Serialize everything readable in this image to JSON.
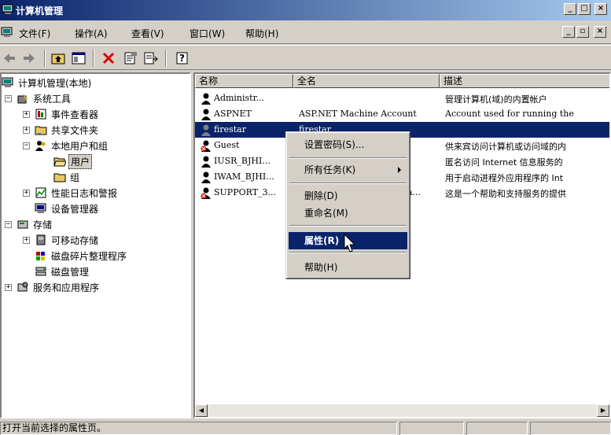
{
  "window": {
    "title": "计算机管理"
  },
  "menubar": {
    "items": [
      "文件(F)",
      "操作(A)",
      "查看(V)",
      "窗口(W)",
      "帮助(H)"
    ]
  },
  "tree": {
    "items": [
      {
        "label": "计算机管理(本地)"
      },
      {
        "label": "系统工具"
      },
      {
        "label": "事件查看器"
      },
      {
        "label": "共享文件夹"
      },
      {
        "label": "本地用户和组"
      },
      {
        "label": "用户"
      },
      {
        "label": "组"
      },
      {
        "label": "性能日志和警报"
      },
      {
        "label": "设备管理器"
      },
      {
        "label": "存储"
      },
      {
        "label": "可移动存储"
      },
      {
        "label": "磁盘碎片整理程序"
      },
      {
        "label": "磁盘管理"
      },
      {
        "label": "服务和应用程序"
      }
    ]
  },
  "list": {
    "columns": [
      "名称",
      "全名",
      "描述"
    ],
    "rows": [
      {
        "name": "Administr...",
        "fullname": "",
        "desc": "管理计算机(域)的内置帐户"
      },
      {
        "name": "ASPNET",
        "fullname": "ASP.NET Machine Account",
        "desc": "Account used for running the"
      },
      {
        "name": "firestar",
        "fullname": "firestar",
        "desc": ""
      },
      {
        "name": "Guest",
        "fullname": "",
        "desc": "供来宾访问计算机或访问域的内"
      },
      {
        "name": "IUSR_BJHI...",
        "fullname": "",
        "desc": "匿名访问 Internet 信息服务的"
      },
      {
        "name": "IWAM_BJHI...",
        "fullname": "",
        "desc": "用于启动进程外应用程序的 Int"
      },
      {
        "name": "SUPPORT_3...",
        "fullname": "a...",
        "desc": "这是一个帮助和支持服务的提供"
      }
    ]
  },
  "context_menu": {
    "set_password": "设置密码(S)...",
    "all_tasks": "所有任务(K)",
    "delete": "删除(D)",
    "rename": "重命名(M)",
    "properties": "属性(R)",
    "help": "帮助(H)"
  },
  "status": {
    "text": "打开当前选择的属性页。"
  },
  "colors": {
    "selection": "#0a246a",
    "chrome": "#d4d0c8"
  }
}
